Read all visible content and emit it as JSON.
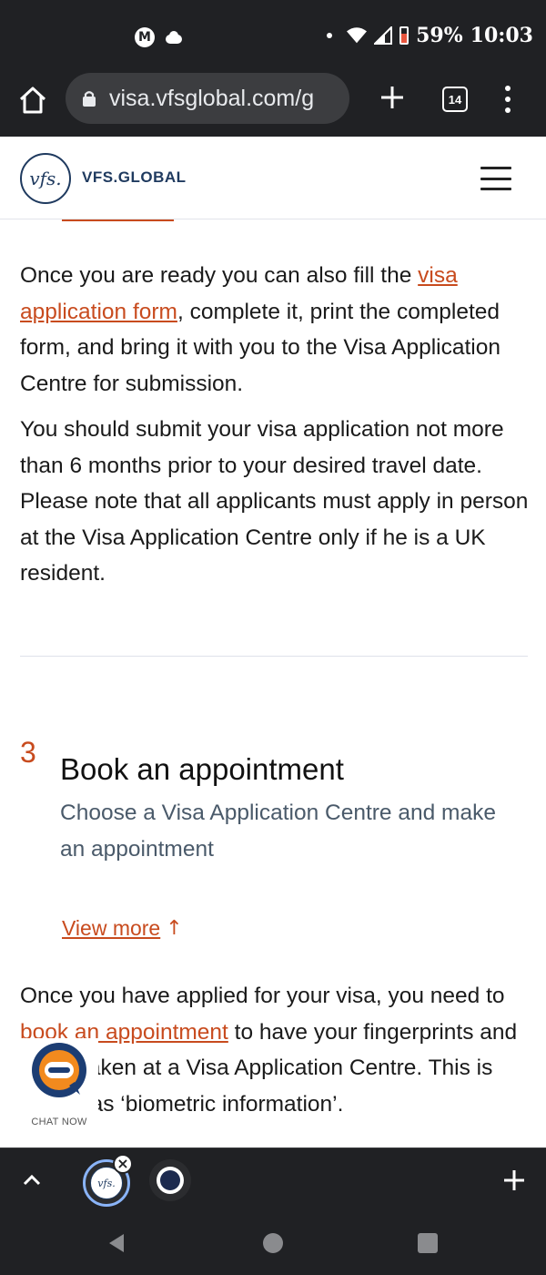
{
  "status_bar": {
    "battery": "59%",
    "time": "10:03"
  },
  "browser": {
    "url": "visa.vfsglobal.com/g",
    "tab_count": "14"
  },
  "site": {
    "logo_mark": "vfs.",
    "logo_text": "VFS.GLOBAL"
  },
  "content": {
    "para1": {
      "before": "Once you are ready you can also fill the ",
      "link": "visa application form",
      "after": ", complete it, print the completed form, and bring it with you to the Visa Application Centre for submission."
    },
    "para2": "You should submit your visa application not more than 6 months prior to your desired travel date. Please note that all applicants must apply in person at the Visa Application Centre only if he is a UK resident.",
    "step": {
      "number": "3",
      "title": "Book an appointment",
      "subtitle": "Choose a Visa Application Centre and make an appointment",
      "view_more": "View more"
    },
    "para3": {
      "before": "Once you have applied for your visa, you need to ",
      "link": "book an appointment",
      "after": " to have your fingerprints and photo taken at a Visa Application Centre. This is known as ‘biometric information’."
    }
  },
  "chat": {
    "label": "CHAT NOW"
  },
  "tab_strip": {
    "fav1_mark": "vfs."
  },
  "colors": {
    "accent": "#c84b1e",
    "navy": "#1f3a5f",
    "chrome": "#202124"
  }
}
